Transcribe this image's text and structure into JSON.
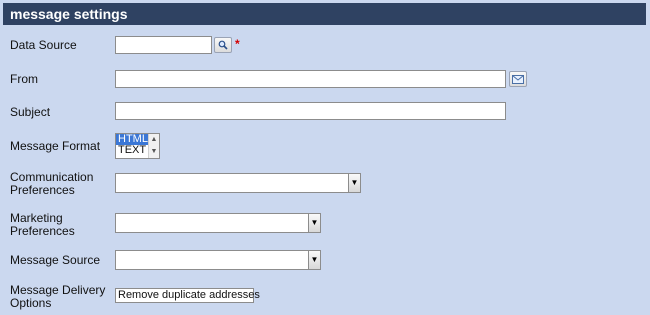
{
  "header": {
    "title": "message settings"
  },
  "fields": {
    "data_source": {
      "label": "Data Source",
      "value": "",
      "required_marker": "*"
    },
    "from": {
      "label": "From",
      "value": ""
    },
    "subject": {
      "label": "Subject",
      "value": ""
    },
    "message_format": {
      "label": "Message Format",
      "options": [
        "HTML",
        "TEXT"
      ],
      "selected": "HTML"
    },
    "communication_preferences": {
      "label_line1": "Communication",
      "label_line2": "Preferences",
      "value": ""
    },
    "marketing_preferences": {
      "label_line1": "Marketing",
      "label_line2": "Preferences",
      "value": ""
    },
    "message_source": {
      "label": "Message Source",
      "value": ""
    },
    "message_delivery_options": {
      "label_line1": "Message Delivery",
      "label_line2": "Options",
      "value": "Remove duplicate addresses"
    }
  },
  "icons": {
    "lookup": "magnifier-icon",
    "address_book": "envelope-icon"
  },
  "colors": {
    "header_bg": "#2f4262",
    "panel_bg": "#cbd8ef",
    "required": "#d40000",
    "selected_option": "#3b77d6"
  }
}
